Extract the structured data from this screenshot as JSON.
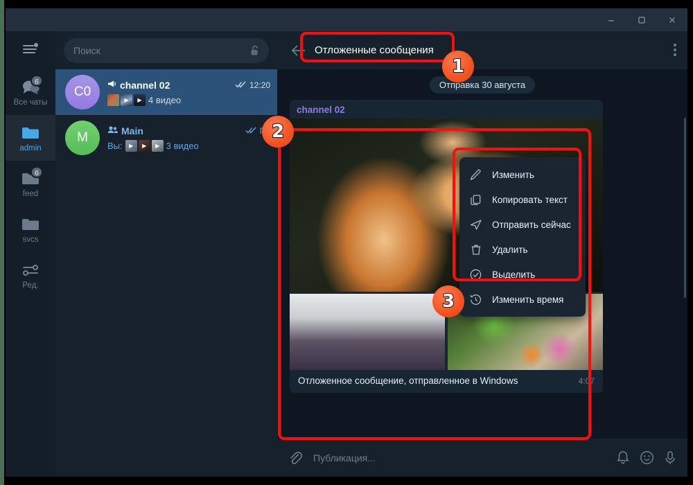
{
  "window": {
    "controls": {
      "minimize": "minimize-icon",
      "maximize": "maximize-icon",
      "close": "close-icon"
    }
  },
  "rail": {
    "menu_icon": "hamburger-menu-icon",
    "items": [
      {
        "label": "Все чаты",
        "icon": "chats-icon",
        "badge": "6",
        "active": false
      },
      {
        "label": "admin",
        "icon": "folder-icon",
        "badge": "",
        "active": true
      },
      {
        "label": "feed",
        "icon": "folder-icon",
        "badge": "6",
        "active": false
      },
      {
        "label": "svcs",
        "icon": "folder-icon",
        "badge": "",
        "active": false
      },
      {
        "label": "Ред.",
        "icon": "settings-sliders-icon",
        "badge": "",
        "active": false
      }
    ]
  },
  "search": {
    "placeholder": "Поиск",
    "lock_icon": "unlocked-padlock-icon"
  },
  "chats": [
    {
      "avatar_initials": "C0",
      "name": "channel 02",
      "name_icon": "megaphone-icon",
      "status_icon": "double-check-icon",
      "time": "12:20",
      "preview_prefix": "",
      "preview": "4 видео",
      "thumb_count": 3,
      "selected": true
    },
    {
      "avatar_initials": "M",
      "name": "Main",
      "name_icon": "group-people-icon",
      "status_icon": "double-check-icon",
      "time": "Пн",
      "preview_prefix": "Вы:",
      "preview": "3 видео",
      "thumb_count": 3,
      "selected": false
    }
  ],
  "pane": {
    "back_icon": "back-arrow-icon",
    "title": "Отложенные сообщения",
    "more_icon": "more-vertical-icon"
  },
  "conversation": {
    "date_pill": "Отправка 30 августа",
    "message": {
      "author": "channel 02",
      "caption": "Отложенное сообщение, отправленное в Windows",
      "time": "4:07",
      "photos": [
        "ginger-maine-coon-cat-photo",
        "city-skyline-river-photo",
        "flowers-ferns-photo"
      ]
    }
  },
  "context_menu": {
    "items": [
      {
        "label": "Изменить",
        "icon": "pencil-icon"
      },
      {
        "label": "Копировать текст",
        "icon": "copy-icon"
      },
      {
        "label": "Отправить сейчас",
        "icon": "send-paperplane-icon"
      },
      {
        "label": "Удалить",
        "icon": "trash-icon"
      },
      {
        "label": "Выделить",
        "icon": "check-circle-icon"
      },
      {
        "label": "Изменить время",
        "icon": "clock-history-icon"
      }
    ]
  },
  "composer": {
    "attach_icon": "paperclip-icon",
    "placeholder": "Публикация...",
    "bell_icon": "bell-icon",
    "emoji_icon": "smiley-icon",
    "mic_icon": "microphone-icon"
  },
  "annotations": {
    "accent_color": "#fb0d0d",
    "badge_color": "#f3521f",
    "badges": [
      {
        "number": "1",
        "target": "pane-title"
      },
      {
        "number": "2",
        "target": "scheduled-message-bubble"
      },
      {
        "number": "3",
        "target": "context-menu"
      }
    ]
  }
}
